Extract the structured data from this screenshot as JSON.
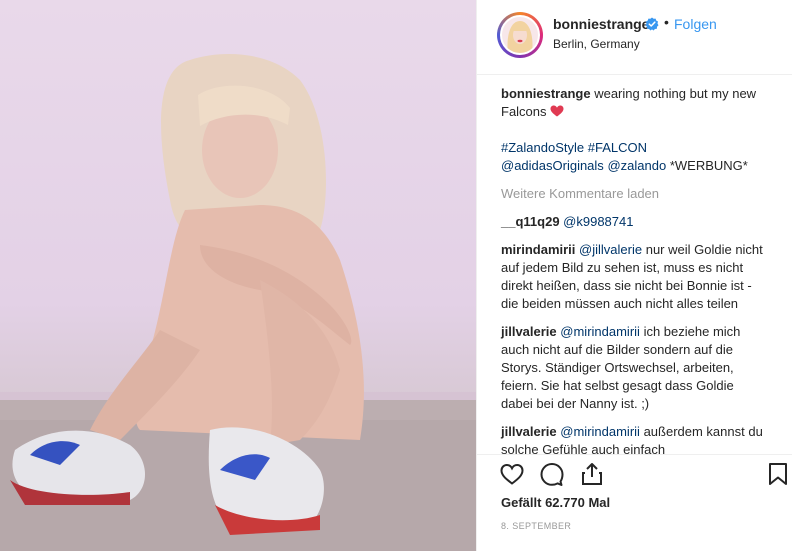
{
  "header": {
    "username": "bonniestrange",
    "separator": "•",
    "follow_label": "Folgen",
    "location": "Berlin, Germany"
  },
  "caption": {
    "username": "bonniestrange",
    "text": "wearing nothing but my new Falcons",
    "tag1": "#ZalandoStyle",
    "tag2": "#FALCON",
    "mention1": "@adidasOriginals",
    "mention2": "@zalando",
    "werbung": "*WERBUNG*"
  },
  "load_more": "Weitere Kommentare laden",
  "comments": [
    {
      "username": "__q11q29",
      "mention": "@k9988741",
      "text": ""
    },
    {
      "username": "mirindamirii",
      "mention": "@jillvalerie",
      "text": "nur weil Goldie nicht auf jedem Bild zu sehen ist, muss es nicht direkt heißen, dass sie nicht bei Bonnie ist - die beiden müssen auch nicht alles teilen"
    },
    {
      "username": "jillvalerie",
      "mention": "@mirindamirii",
      "text": "ich beziehe mich auch nicht auf die Bilder sondern auf die Storys. Ständiger Ortswechsel, arbeiten, feiern. Sie hat selbst gesagt dass Goldie dabei bei der Nanny ist. ;)"
    },
    {
      "username": "jillvalerie",
      "mention": "@mirindamirii",
      "text": "außerdem kannst du solche Gefühle auch einfach"
    }
  ],
  "likes": "Gefällt 62.770 Mal",
  "date": "8. SEPTEMBER",
  "icons": {
    "like": "heart-outline-icon",
    "comment": "speech-bubble-icon",
    "share": "share-icon",
    "save": "bookmark-icon",
    "verified": "verified-badge-icon",
    "caption_heart": "red-heart-emoji"
  },
  "colors": {
    "link": "#3897f0",
    "tag": "#003569",
    "muted": "#999999",
    "verified": "#3897f0",
    "heart": "#ed4956"
  }
}
